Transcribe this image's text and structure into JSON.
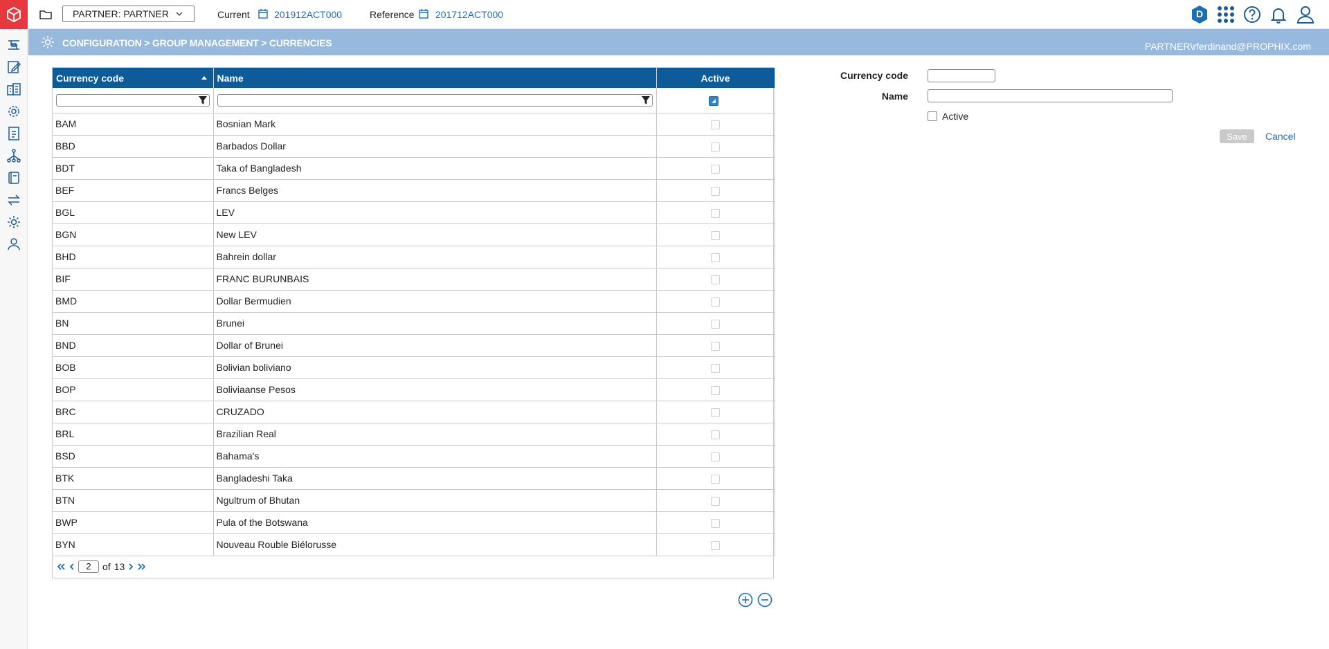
{
  "topbar": {
    "entity_selector": "PARTNER: PARTNER",
    "current_label": "Current",
    "current_value": "201912ACT000",
    "reference_label": "Reference",
    "reference_value": "201712ACT000",
    "badge_letter": "D"
  },
  "banner": {
    "breadcrumb": "CONFIGURATION > GROUP MANAGEMENT > CURRENCIES",
    "user": "PARTNER\\rferdinand@PROPHIX.com"
  },
  "grid": {
    "headers": {
      "code": "Currency code",
      "name": "Name",
      "active": "Active"
    },
    "rows": [
      {
        "code": "BAM",
        "name": "Bosnian Mark"
      },
      {
        "code": "BBD",
        "name": "Barbados Dollar"
      },
      {
        "code": "BDT",
        "name": "Taka of Bangladesh"
      },
      {
        "code": "BEF",
        "name": "Francs Belges"
      },
      {
        "code": "BGL",
        "name": "LEV"
      },
      {
        "code": "BGN",
        "name": "New LEV"
      },
      {
        "code": "BHD",
        "name": "Bahrein dollar"
      },
      {
        "code": "BIF",
        "name": "FRANC BURUNBAIS"
      },
      {
        "code": "BMD",
        "name": "Dollar Bermudien"
      },
      {
        "code": "BN",
        "name": "Brunei"
      },
      {
        "code": "BND",
        "name": "Dollar of Brunei"
      },
      {
        "code": "BOB",
        "name": "Bolivian boliviano"
      },
      {
        "code": "BOP",
        "name": "Boliviaanse Pesos"
      },
      {
        "code": "BRC",
        "name": "CRUZADO"
      },
      {
        "code": "BRL",
        "name": "Brazilian Real"
      },
      {
        "code": "BSD",
        "name": "Bahama's"
      },
      {
        "code": "BTK",
        "name": "Bangladeshi Taka"
      },
      {
        "code": "BTN",
        "name": "Ngultrum of Bhutan"
      },
      {
        "code": "BWP",
        "name": "Pula of the Botswana"
      },
      {
        "code": "BYN",
        "name": "Nouveau Rouble Biélorusse"
      }
    ],
    "pager": {
      "page": "2",
      "of_label": "of",
      "total": "13"
    }
  },
  "form": {
    "code_label": "Currency code",
    "name_label": "Name",
    "active_label": "Active",
    "save_label": "Save",
    "cancel_label": "Cancel"
  },
  "colors": {
    "brand_red": "#e8383d",
    "header_blue": "#0d5c99",
    "banner_blue": "#96b9dd",
    "link_blue": "#1a6fb5"
  }
}
